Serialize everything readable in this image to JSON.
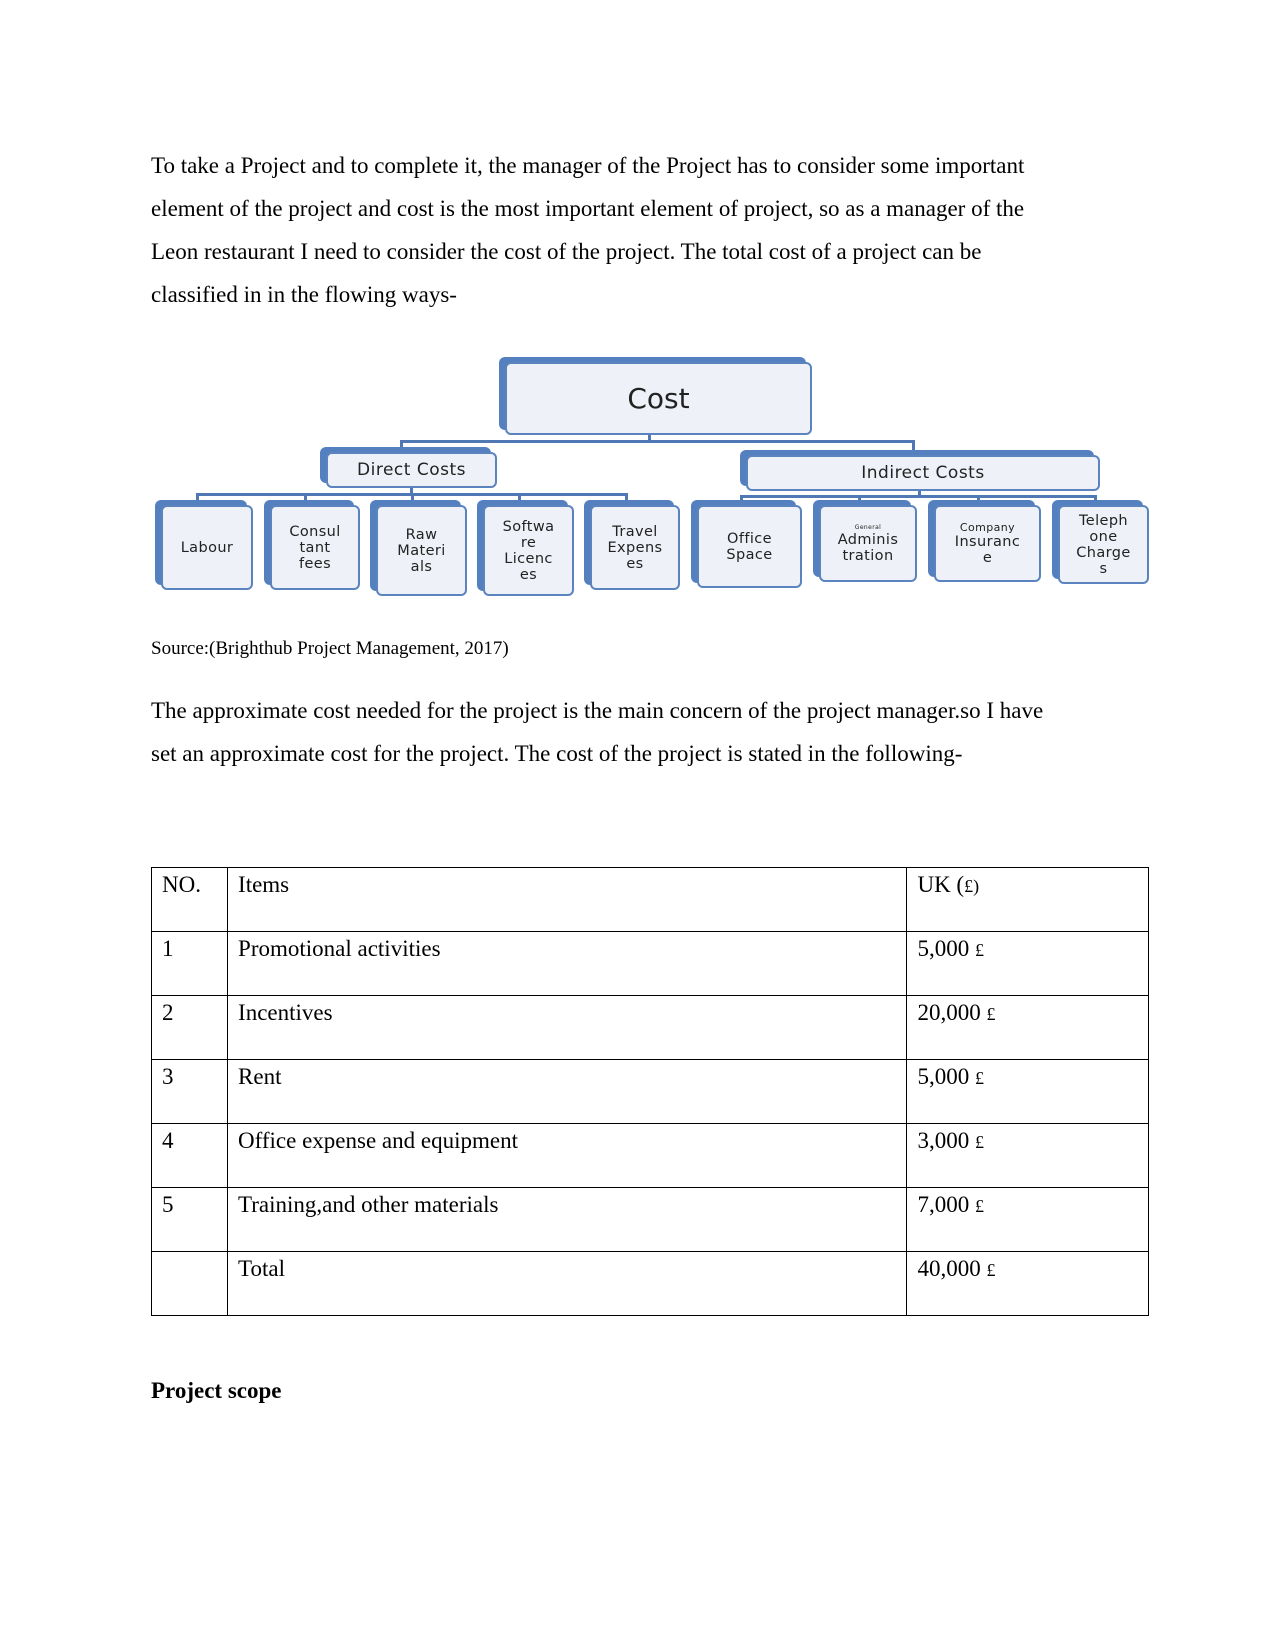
{
  "intro_paragraph": "To take a Project and to complete it, the manager of the Project has to consider some important element of the project and cost is the most important element of project, so as a manager of the Leon restaurant I need to consider the cost of the project. The total cost of a project can be classified in in the flowing ways-",
  "intro_lines": [
    "To take a Project and to complete it, the manager of the Project has to consider some important",
    "element of the project and cost is the most important element of project, so as a manager of the",
    "Leon restaurant I need to consider the cost of the project. The total cost of a project can be",
    "classified in in the flowing ways-"
  ],
  "diagram": {
    "root": "Cost",
    "direct": {
      "label": "Direct Costs",
      "children": [
        {
          "lines": [
            "Labour"
          ]
        },
        {
          "lines": [
            "Consul",
            "tant",
            "fees"
          ]
        },
        {
          "lines": [
            "Raw",
            "Materi",
            "als"
          ]
        },
        {
          "lines": [
            "Softwa",
            "re",
            "Licenc",
            "es"
          ]
        },
        {
          "lines": [
            "Travel",
            "Expens",
            "es"
          ]
        }
      ]
    },
    "indirect": {
      "label": "Indirect Costs",
      "children": [
        {
          "lines": [
            "Office",
            "Space"
          ]
        },
        {
          "small": "General",
          "lines": [
            "Adminis",
            "tration"
          ]
        },
        {
          "small": "Company",
          "lines": [
            "Insuranc",
            "e"
          ]
        },
        {
          "lines": [
            "Teleph",
            "one",
            "Charge",
            "s"
          ]
        }
      ]
    },
    "colors": {
      "border": "#5b84bf",
      "fill": "#eef2f8",
      "connector": "#4f78b4"
    }
  },
  "source_caption": "Source:(Brighthub Project Management, 2017)",
  "cost_lines": [
    "The approximate cost needed for the project is the main concern of the project manager.so I have",
    "set an approximate cost for the project. The cost of the project is stated in the following-"
  ],
  "table": {
    "headers": {
      "no": "NO.",
      "items": "Items",
      "uk": "UK (",
      "uk_symbol": "£",
      "uk_close": ")"
    },
    "rows": [
      {
        "no": "1",
        "item": "Promotional activities",
        "amount": "5,000",
        "symbol": "£"
      },
      {
        "no": "2",
        "item": "Incentives",
        "amount": "20,000",
        "symbol": "£"
      },
      {
        "no": "3",
        "item": "Rent",
        "amount": "5,000",
        "symbol": "£"
      },
      {
        "no": "4",
        "item": "Office expense and equipment",
        "amount": "3,000",
        "symbol": "£"
      },
      {
        "no": "5",
        "item": "Training,and other materials",
        "amount": "7,000",
        "symbol": "£"
      },
      {
        "no": "",
        "item": "Total",
        "amount": "40,000",
        "symbol": "£"
      }
    ]
  },
  "section_heading": "Project scope"
}
